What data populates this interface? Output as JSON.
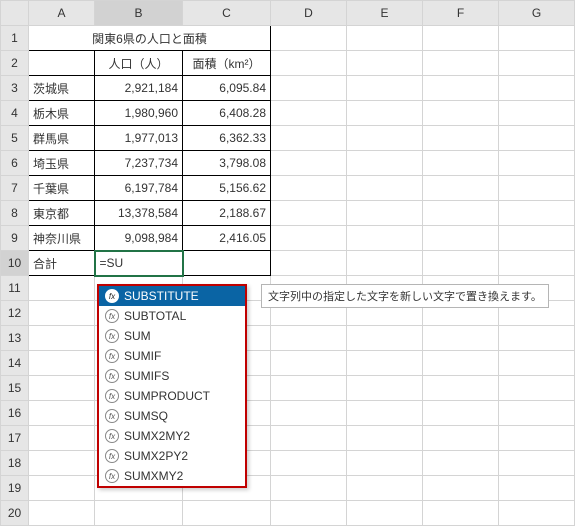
{
  "columns": [
    "A",
    "B",
    "C",
    "D",
    "E",
    "F",
    "G"
  ],
  "rows": [
    "1",
    "2",
    "3",
    "4",
    "5",
    "6",
    "7",
    "8",
    "9",
    "10",
    "11",
    "12",
    "13",
    "14",
    "15",
    "16",
    "17",
    "18",
    "19",
    "20"
  ],
  "title": "関東6県の人口と面積",
  "headers": {
    "pop": "人口（人）",
    "area": "面積（km²）"
  },
  "prefs": [
    {
      "name": "茨城県",
      "pop": "2,921,184",
      "area": "6,095.84"
    },
    {
      "name": "栃木県",
      "pop": "1,980,960",
      "area": "6,408.28"
    },
    {
      "name": "群馬県",
      "pop": "1,977,013",
      "area": "6,362.33"
    },
    {
      "name": "埼玉県",
      "pop": "7,237,734",
      "area": "3,798.08"
    },
    {
      "name": "千葉県",
      "pop": "6,197,784",
      "area": "5,156.62"
    },
    {
      "name": "東京都",
      "pop": "13,378,584",
      "area": "2,188.67"
    },
    {
      "name": "神奈川県",
      "pop": "9,098,984",
      "area": "2,416.05"
    }
  ],
  "total_label": "合計",
  "editing_value": "=SU",
  "suggestions": [
    "SUBSTITUTE",
    "SUBTOTAL",
    "SUM",
    "SUMIF",
    "SUMIFS",
    "SUMPRODUCT",
    "SUMSQ",
    "SUMX2MY2",
    "SUMX2PY2",
    "SUMXMY2"
  ],
  "tooltip": "文字列中の指定した文字を新しい文字で置き換えます。",
  "chart_data": {
    "type": "table",
    "title": "関東6県の人口と面積",
    "columns": [
      "人口（人）",
      "面積（km²）"
    ],
    "categories": [
      "茨城県",
      "栃木県",
      "群馬県",
      "埼玉県",
      "千葉県",
      "東京都",
      "神奈川県"
    ],
    "series": [
      {
        "name": "人口（人）",
        "values": [
          2921184,
          1980960,
          1977013,
          7237734,
          6197784,
          13378584,
          9098984
        ]
      },
      {
        "name": "面積（km²）",
        "values": [
          6095.84,
          6408.28,
          6362.33,
          3798.08,
          5156.62,
          2188.67,
          2416.05
        ]
      }
    ]
  }
}
